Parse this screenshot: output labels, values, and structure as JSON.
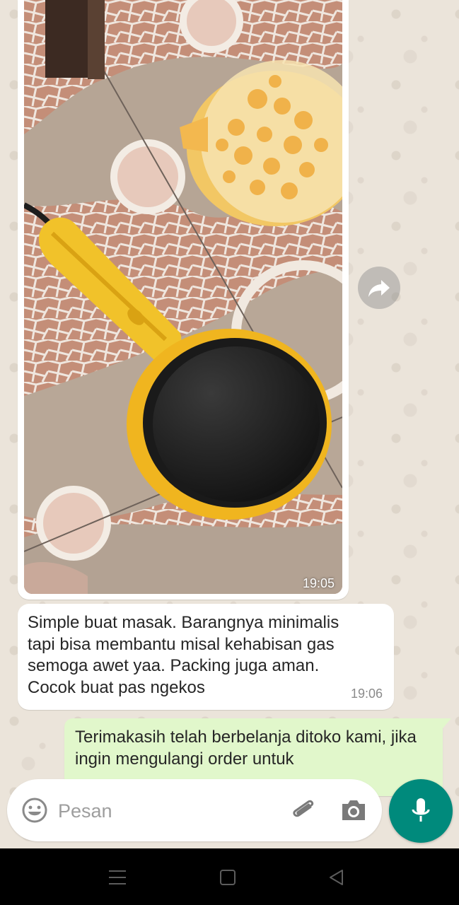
{
  "chat": {
    "image_message": {
      "time": "19:05"
    },
    "incoming_message": {
      "text": "Simple buat masak. Barangnya minimalis tapi bisa membantu misal kehabisan gas semoga awet yaa. Packing juga aman. Cocok buat pas ngekos",
      "time": "19:06"
    },
    "outgoing_message": {
      "text": "Terimakasih telah berbelanja ditoko kami, jika ingin mengulangi order untuk"
    }
  },
  "composer": {
    "placeholder": "Pesan",
    "icons": [
      "emoji-icon",
      "attach-icon",
      "camera-icon",
      "mic-icon"
    ]
  },
  "icons": {
    "forward": "forward-arrow-icon",
    "nav": [
      "menu-icon",
      "home-icon",
      "back-icon"
    ]
  },
  "colors": {
    "accent": "#008a7c",
    "outgoing_bubble": "#e1f7cb",
    "incoming_bubble": "#ffffff",
    "wallpaper": "#ebe4da"
  }
}
